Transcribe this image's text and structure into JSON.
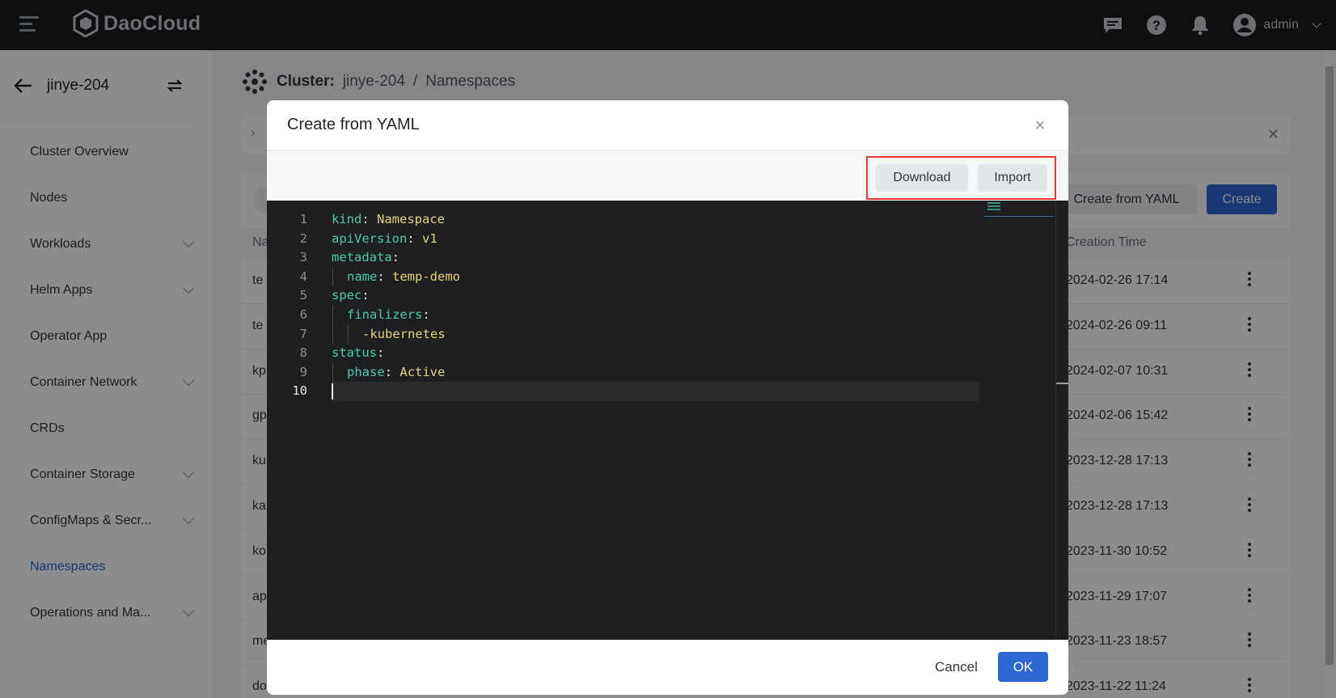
{
  "topbar": {
    "brand": "DaoCloud",
    "user": "admin"
  },
  "sidebar": {
    "cluster": "jinye-204",
    "items": [
      {
        "label": "Cluster Overview",
        "expandable": false
      },
      {
        "label": "Nodes",
        "expandable": false
      },
      {
        "label": "Workloads",
        "expandable": true
      },
      {
        "label": "Helm Apps",
        "expandable": true
      },
      {
        "label": "Operator App",
        "expandable": false
      },
      {
        "label": "Container Network",
        "expandable": true
      },
      {
        "label": "CRDs",
        "expandable": false
      },
      {
        "label": "Container Storage",
        "expandable": true
      },
      {
        "label": "ConfigMaps & Secr...",
        "expandable": true
      },
      {
        "label": "Namespaces",
        "expandable": false,
        "active": true
      },
      {
        "label": "Operations and Ma...",
        "expandable": true
      }
    ]
  },
  "breadcrumb": {
    "label": "Cluster:",
    "cluster": "jinye-204",
    "separator": "/",
    "page": "Namespaces"
  },
  "main": {
    "create_from_yaml_label": "Create from YAML",
    "create_label": "Create",
    "columns": {
      "name": "Na",
      "creation_time": "Creation Time"
    },
    "rows": [
      {
        "name": "te",
        "time": "2024-02-26 17:14"
      },
      {
        "name": "te",
        "time": "2024-02-26 09:11"
      },
      {
        "name": "kp",
        "time": "2024-02-07 10:31"
      },
      {
        "name": "gp",
        "time": "2024-02-06 15:42"
      },
      {
        "name": "ku",
        "time": "2023-12-28 17:13"
      },
      {
        "name": "ka",
        "time": "2023-12-28 17:13"
      },
      {
        "name": "ko",
        "time": "2023-11-30 10:52"
      },
      {
        "name": "ap",
        "time": "2023-11-29 17:07"
      },
      {
        "name": "me",
        "time": "2023-11-23 18:57"
      },
      {
        "name": "do",
        "time": "2023-11-22 11:24"
      }
    ]
  },
  "modal": {
    "title": "Create from YAML",
    "download_label": "Download",
    "import_label": "Import",
    "cancel_label": "Cancel",
    "ok_label": "OK",
    "highlight_color": "#e53935",
    "editor": {
      "current_line": 10,
      "lines": [
        {
          "indent": 0,
          "key": "kind",
          "value": "Namespace"
        },
        {
          "indent": 0,
          "key": "apiVersion",
          "value": "v1"
        },
        {
          "indent": 0,
          "key": "metadata",
          "value": ""
        },
        {
          "indent": 1,
          "key": "name",
          "value": "temp-demo"
        },
        {
          "indent": 0,
          "key": "spec",
          "value": ""
        },
        {
          "indent": 1,
          "key": "finalizers",
          "value": ""
        },
        {
          "indent": 2,
          "key": "",
          "value": "-kubernetes"
        },
        {
          "indent": 0,
          "key": "status",
          "value": ""
        },
        {
          "indent": 1,
          "key": "phase",
          "value": "Active"
        },
        {
          "indent": 0,
          "key": "",
          "value": ""
        }
      ]
    }
  },
  "colors": {
    "primary": "#2c68d4",
    "topbar": "#1b1c1e",
    "yaml_key": "#4ec9b0",
    "yaml_value": "#e6d37a"
  }
}
